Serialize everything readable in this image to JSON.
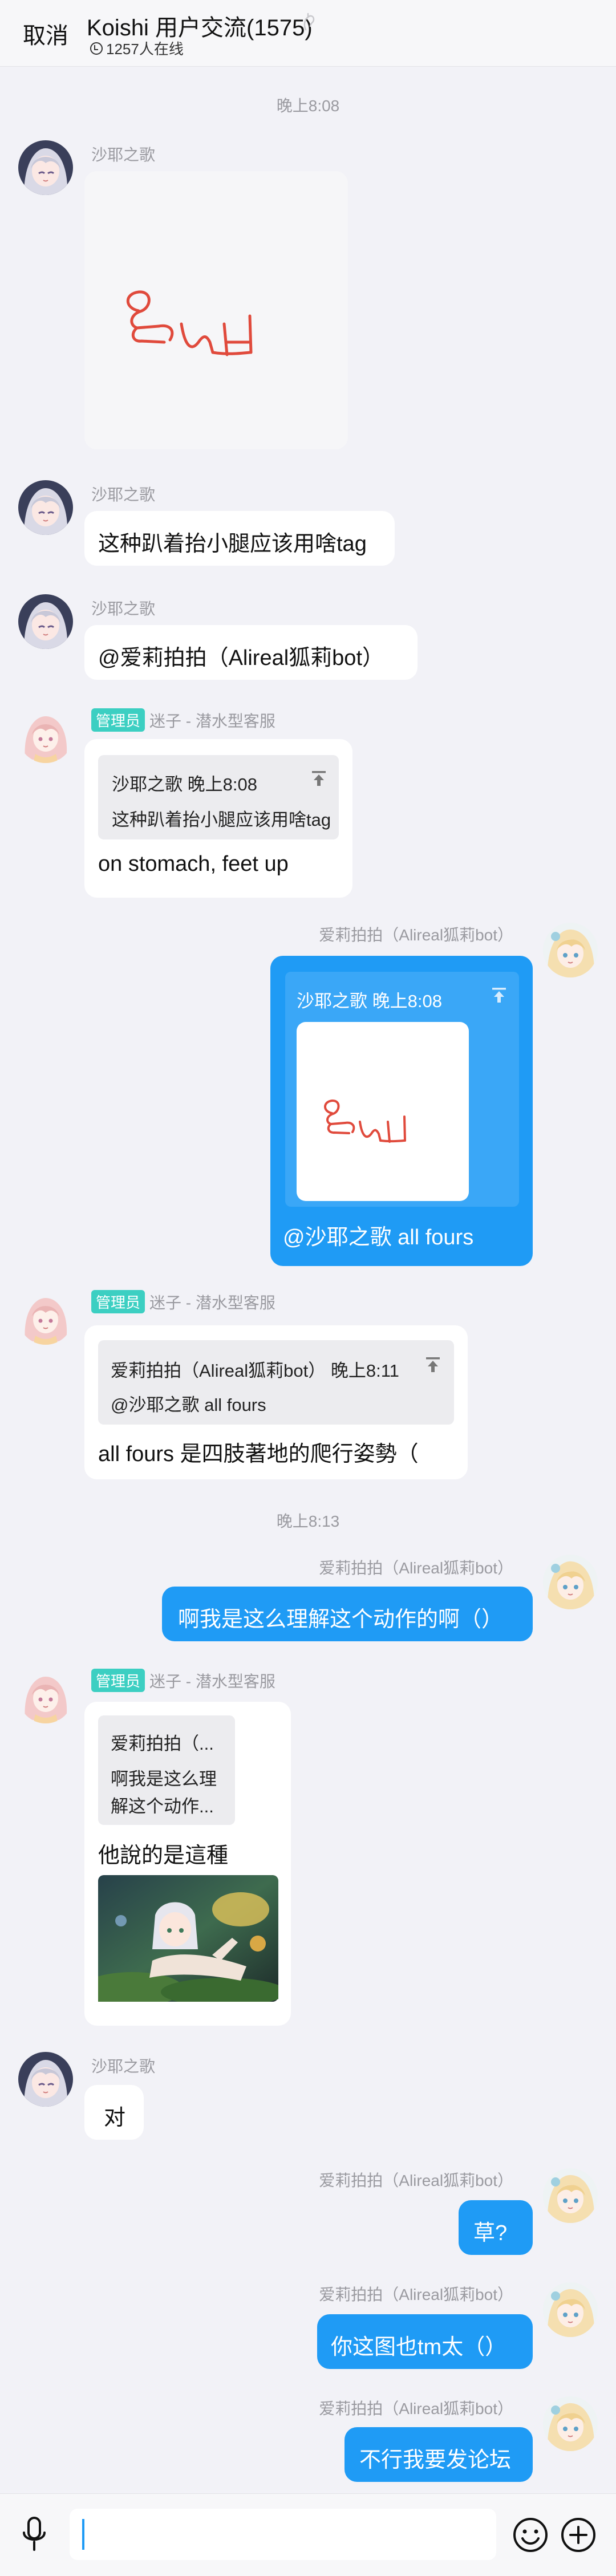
{
  "header": {
    "cancel_label": "取消",
    "title": "Koishi 用户交流(1575)",
    "online": "1257人在线"
  },
  "messages": {
    "t1": "晚上8:08",
    "m1_name": "沙耶之歌",
    "m2_name": "沙耶之歌",
    "m2_text": "这种趴着抬小腿应该用啥tag",
    "m3_name": "沙耶之歌",
    "m3_text": "@爱莉拍拍（Alireal狐莉bot）",
    "m4_badge": "管理员",
    "m4_name": "迷子 - 潜水型客服",
    "m4_quote_head": "沙耶之歌 晚上8:08",
    "m4_quote_body": "这种趴着抬小腿应该用啥tag",
    "m4_text": "on stomach, feet up",
    "m5_name": "爱莉拍拍（Alireal狐莉bot）",
    "m5_quote_head": "沙耶之歌 晚上8:08",
    "m5_text": "@沙耶之歌 all fours",
    "m6_badge": "管理员",
    "m6_name": "迷子 - 潜水型客服",
    "m6_quote_head": "爱莉拍拍（Alireal狐莉bot） 晚上8:11",
    "m6_quote_body": "@沙耶之歌 all fours",
    "m6_text": "all fours 是四肢著地的爬行姿勢（",
    "t2": "晚上8:13",
    "m7_name": "爱莉拍拍（Alireal狐莉bot）",
    "m7_text": "啊我是这么理解这个动作的啊（）",
    "m8_badge": "管理员",
    "m8_name": "迷子 - 潜水型客服",
    "m8_quote_head": "爱莉拍拍（...",
    "m8_quote_body1": "啊我是这么理",
    "m8_quote_body2": "解这个动作...",
    "m8_text": "他說的是這種",
    "m9_name": "沙耶之歌",
    "m9_text": "对",
    "m10_name": "爱莉拍拍（Alireal狐莉bot）",
    "m10_text": "草?",
    "m11_name": "爱莉拍拍（Alireal狐莉bot）",
    "m11_text": "你这图也tm太（）",
    "m12_name": "爱莉拍拍（Alireal狐莉bot）",
    "m12_text": "不行我要发论坛"
  },
  "colors": {
    "accent": "#1f9bf5",
    "admin_badge": "#3ccfc2",
    "background": "#f2f2f7"
  },
  "icons": [
    "hand-icon",
    "online-check-icon",
    "jump-to-quote-icon",
    "microphone-icon",
    "emoji-icon",
    "plus-icon"
  ]
}
